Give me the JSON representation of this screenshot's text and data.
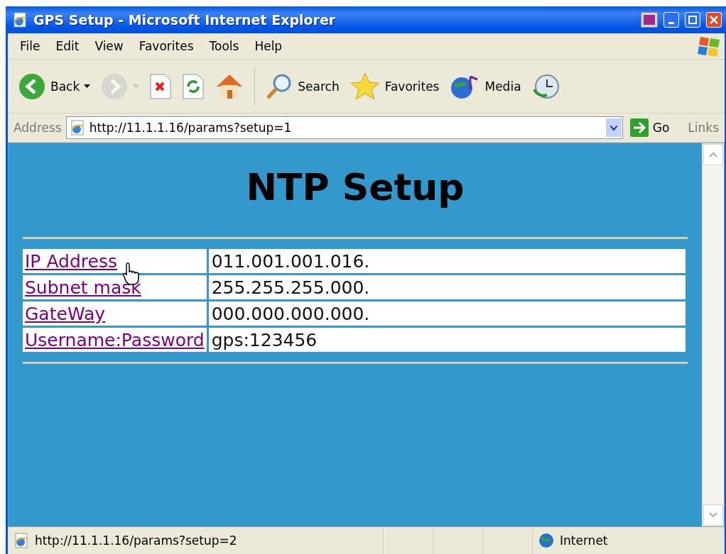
{
  "window": {
    "title": "GPS Setup - Microsoft Internet Explorer"
  },
  "menu": [
    "File",
    "Edit",
    "View",
    "Favorites",
    "Tools",
    "Help"
  ],
  "toolbar": [
    {
      "kind": "back",
      "label": "Back",
      "disabled": false
    },
    {
      "kind": "forward",
      "disabled": true
    },
    {
      "kind": "stop",
      "disabled": false
    },
    {
      "kind": "refresh",
      "disabled": false
    },
    {
      "kind": "home",
      "disabled": false
    },
    {
      "kind": "search",
      "label": "Search",
      "disabled": false
    },
    {
      "kind": "favorites",
      "label": "Favorites",
      "disabled": false
    },
    {
      "kind": "media",
      "label": "Media",
      "disabled": false
    },
    {
      "kind": "history",
      "disabled": false
    }
  ],
  "address": {
    "label": "Address",
    "url": "http://11.1.1.16/params?setup=1",
    "go": "Go",
    "links": "Links"
  },
  "page": {
    "heading": "NTP Setup",
    "rows": [
      {
        "label": "IP Address",
        "value": "011.001.001.016."
      },
      {
        "label": "Subnet mask",
        "value": "255.255.255.000."
      },
      {
        "label": "GateWay",
        "value": "000.000.000.000."
      },
      {
        "label": "Username:Password",
        "value": "gps:123456"
      }
    ]
  },
  "status_bar": {
    "url": "http://11.1.1.16/params?setup=2",
    "zone": "Internet"
  }
}
